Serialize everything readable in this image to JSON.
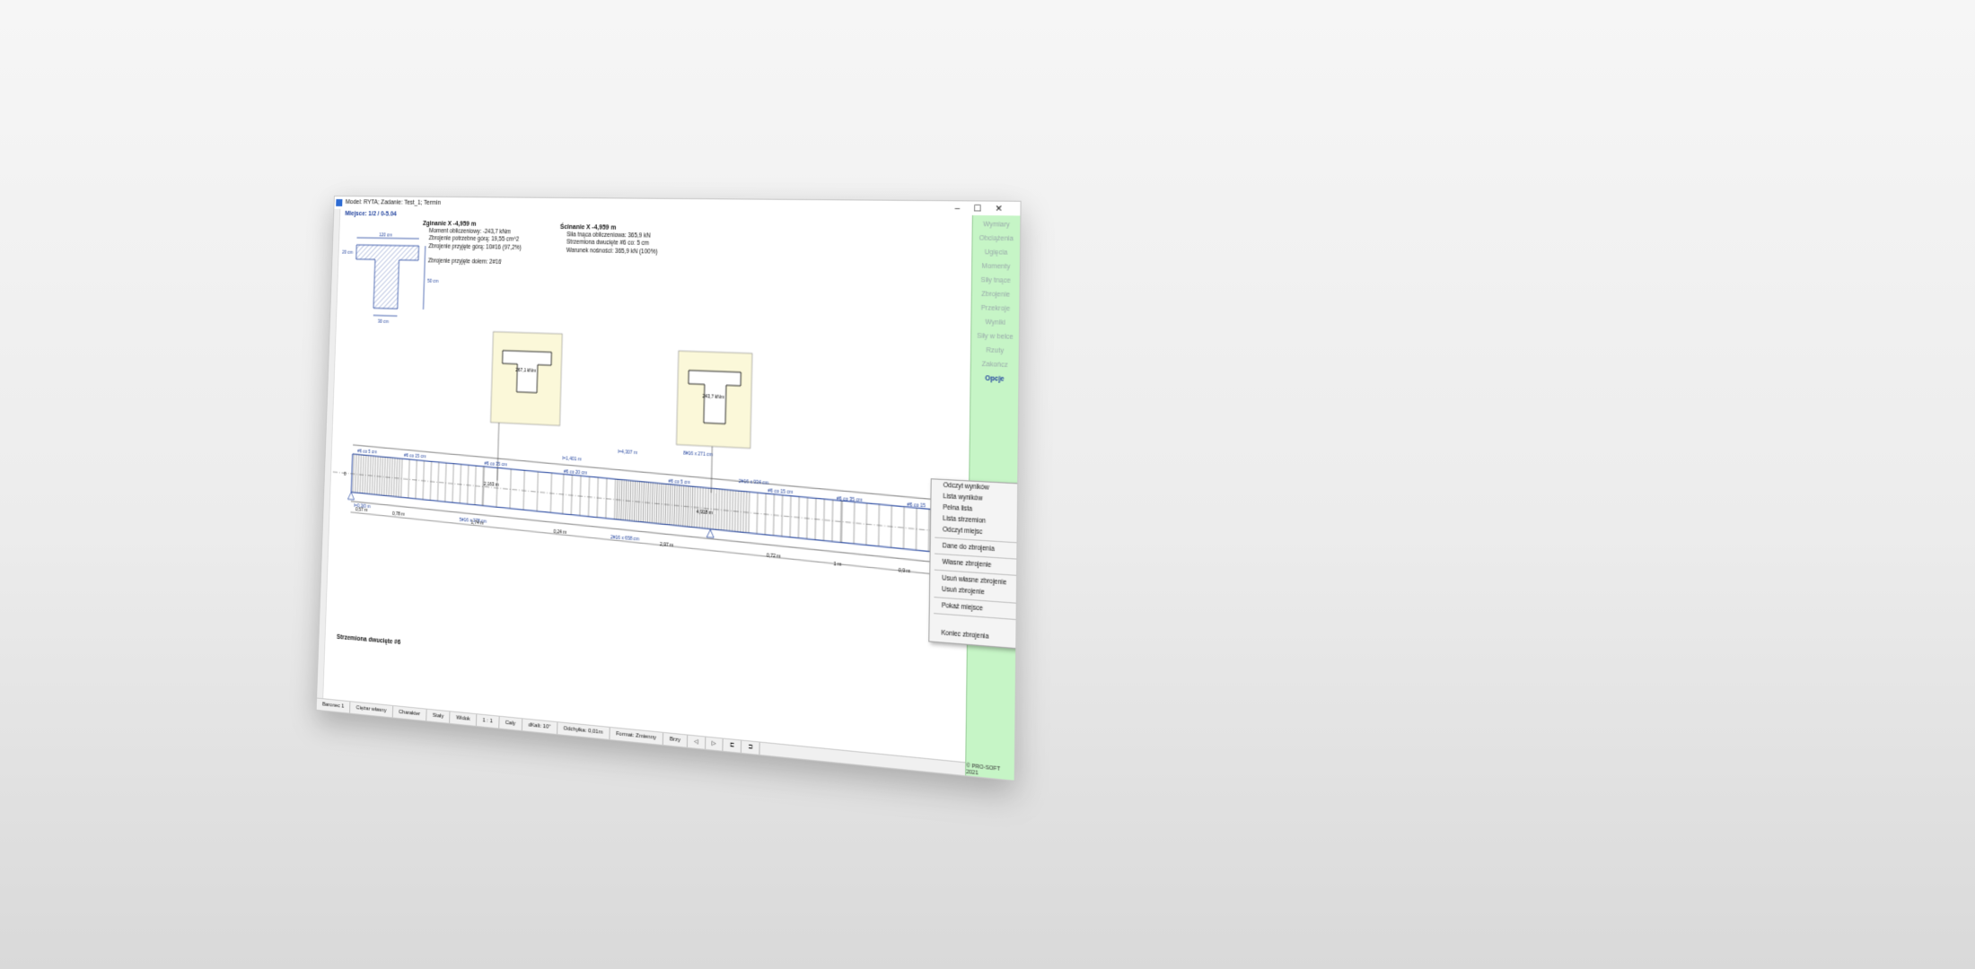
{
  "window": {
    "title": "Model: RYTA; Zadanie: Test_1; Termin",
    "minimize": "–",
    "maximize": "☐",
    "close": "✕"
  },
  "place_label": "Miejsce: 1/2 / 0-5.04",
  "bending": {
    "title": "Zginanie X -4,959 m",
    "lines": [
      "Moment obliczeniowy: -243,7 kNm",
      "Zbrojenie potrzebne górą: 19,55 cm^2",
      "Zbrojenie przyjęte górą: 10#16 (97,2%)"
    ],
    "bottom": "Zbrojenie przyjęte dołem: 2#16"
  },
  "shear": {
    "title": "Ścinanie X -4,959 m",
    "lines": [
      "Siła tnąca obliczeniowa: 365,9 kN",
      "Strzemiona dwucięte #6 co: 5 cm",
      "Warunek nośności: 365,9 kN (100%)"
    ]
  },
  "section": {
    "top_width": "120 cm",
    "bottom_width": "30 cm",
    "flange_h": "20 cm",
    "height": "50 cm"
  },
  "popup_left": {
    "moment": "267,1 kNm"
  },
  "popup_right": {
    "moment": "243,7 kNm"
  },
  "beam_labels": {
    "stirrups": [
      "#6 co 5 cm",
      "#6 co 15 cm",
      "#6 co 35 cm",
      "#6 co 20 cm",
      "#6 co 5 cm",
      "#6 co 15 cm",
      "#6 co 35 cm",
      "#6 co 15"
    ],
    "upper_bars": [
      "l=1,401 m",
      "l=4,307 m",
      "8#16 x 271 cm",
      "2#16 x 934 cm"
    ],
    "lower_bars": [
      "l=0,3/0 m",
      "5#16 x 378 cm",
      "2#16 x 658 cm"
    ],
    "dims": [
      "0,57 m",
      "0,78 m",
      "1,74 m",
      "0,24 m",
      "2,97 m",
      "0,72 m",
      "1 m",
      "0,9 m"
    ],
    "points": [
      "2,163 m",
      "4,918 m",
      "0"
    ]
  },
  "stirrups_note": "Strzemiona dwucięte #6",
  "statusbar": [
    "Baronec 1",
    "Ciężar własny",
    "Charakter",
    "Stały",
    "Widok",
    "1 : 1",
    "Cały",
    "dKalt: 10\"",
    "Odchyłka: 0,01m",
    "Format: Zmienny",
    "Brzy",
    "◁",
    "▷",
    "⊏",
    "⊐"
  ],
  "sidebar": {
    "items": [
      "Wymiary",
      "Obciążenia",
      "Ugięcia",
      "Momenty",
      "Siły tnące",
      "Zbrojenie",
      "Przekroje",
      "Wyniki",
      "Siły w belce",
      "Rzuty",
      "Zakończ",
      "Opcje"
    ],
    "active": "Opcje"
  },
  "copyright": "© PRO-SOFT 2021",
  "context_menu": {
    "items": [
      {
        "label": "Odczyt wyników"
      },
      {
        "label": "Lista wyników"
      },
      {
        "label": "Pełna lista"
      },
      {
        "label": "Lista strzemion"
      },
      {
        "label": "Odczyt miejsc"
      },
      {
        "sep": true
      },
      {
        "label": "Dane do zbrojenia"
      },
      {
        "sep": true
      },
      {
        "label": "Własne zbrojenie",
        "arrow": "›"
      },
      {
        "sep": true
      },
      {
        "label": "Usuń własne zbrojenie",
        "arrow": "›"
      },
      {
        "label": "Usuń zbrojenie"
      },
      {
        "sep": true
      },
      {
        "label": "Pokaż miejsce"
      },
      {
        "sep": true
      },
      {
        "label": ""
      },
      {
        "label": "Koniec zbrojenia"
      }
    ]
  }
}
